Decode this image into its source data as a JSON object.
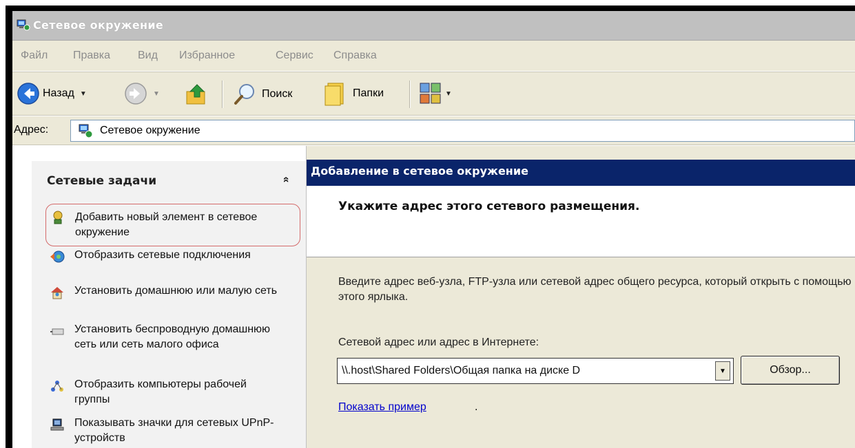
{
  "window": {
    "title": "Сетевое окружение"
  },
  "menu": {
    "items": [
      "Файл",
      "Правка",
      "Вид",
      "Избранное",
      "Сервис",
      "Справка"
    ]
  },
  "toolbar": {
    "back_label": "Назад",
    "search_label": "Поиск",
    "folders_label": "Папки"
  },
  "address": {
    "label": "Адрес:",
    "value": "Сетевое окружение"
  },
  "sidebar": {
    "title": "Сетевые задачи",
    "collapse_glyph": "«",
    "tasks": [
      {
        "label": "Добавить новый элемент в сетевое окружение",
        "icon": "network-add-icon"
      },
      {
        "label": "Отобразить сетевые подключения",
        "icon": "network-connections-icon"
      },
      {
        "label": "Установить домашнюю или малую сеть",
        "icon": "home-network-icon"
      },
      {
        "label": "Установить беспроводную домашнюю сеть или сеть малого офиса",
        "icon": "wireless-network-icon"
      },
      {
        "label": "Отобразить компьютеры рабочей группы",
        "icon": "workgroup-icon"
      },
      {
        "label": "Показывать значки для сетевых UPnP-устройств",
        "icon": "upnp-device-icon"
      }
    ]
  },
  "wizard": {
    "header": "Добавление в сетевое окружение",
    "subtitle": "Укажите адрес этого сетевого размещения.",
    "description": "Введите адрес веб-узла, FTP-узла или сетевой адрес общего ресурса, который открыть с помощью этого ярлыка.",
    "field_label": "Сетевой адрес или адрес в Интернете:",
    "field_value": "\\\\.host\\Shared Folders\\Общая папка на диске D",
    "browse_label": "Обзор...",
    "example_link": "Показать пример"
  },
  "colors": {
    "header_bg": "#0a246a",
    "panel_bg": "#ece9d8",
    "link": "#0000cc",
    "highlight_border": "#d46a6a"
  }
}
